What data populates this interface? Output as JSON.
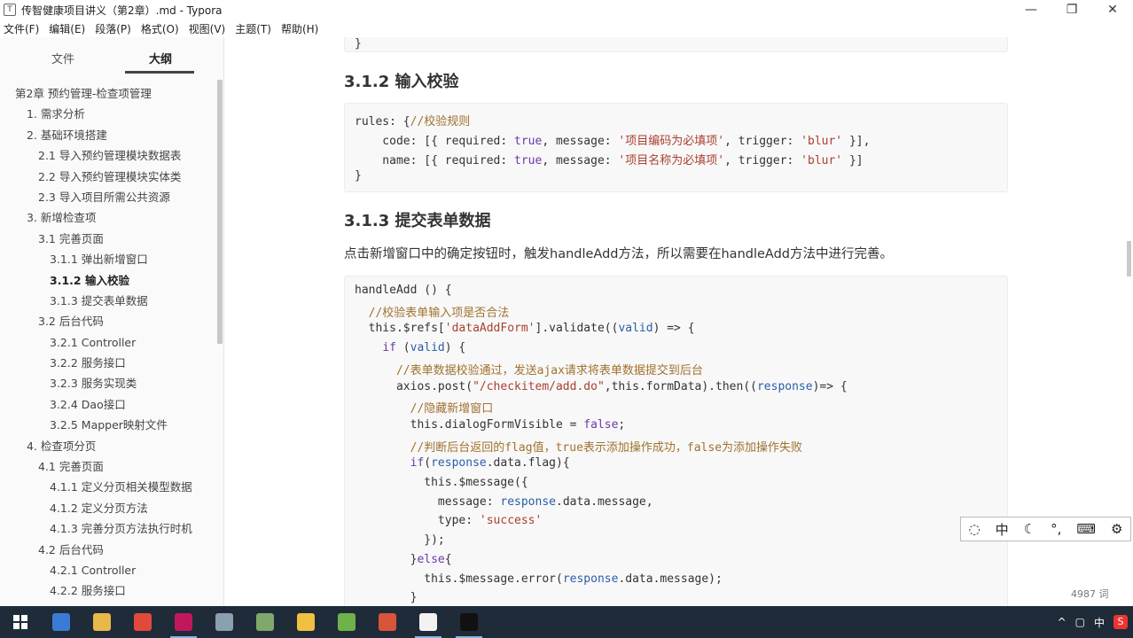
{
  "window": {
    "title": "传智健康项目讲义（第2章）.md - Typora",
    "app_icon": "T"
  },
  "window_controls": {
    "minimize": "—",
    "maximize": "❐",
    "close": "✕"
  },
  "menu": [
    "文件(F)",
    "编辑(E)",
    "段落(P)",
    "格式(O)",
    "视图(V)",
    "主题(T)",
    "帮助(H)"
  ],
  "sidebar": {
    "tabs": [
      "文件",
      "大纲"
    ],
    "active_tab": "大纲",
    "outline": [
      {
        "label": "第2章 预约管理-检查项管理",
        "level": 0
      },
      {
        "label": "1. 需求分析",
        "level": 1
      },
      {
        "label": "2. 基础环境搭建",
        "level": 1
      },
      {
        "label": "2.1 导入预约管理模块数据表",
        "level": 2
      },
      {
        "label": "2.2 导入预约管理模块实体类",
        "level": 2
      },
      {
        "label": "2.3 导入项目所需公共资源",
        "level": 2
      },
      {
        "label": "3. 新增检查项",
        "level": 1
      },
      {
        "label": "3.1 完善页面",
        "level": 2
      },
      {
        "label": "3.1.1 弹出新增窗口",
        "level": 3
      },
      {
        "label": "3.1.2 输入校验",
        "level": 3,
        "active": true
      },
      {
        "label": "3.1.3 提交表单数据",
        "level": 3
      },
      {
        "label": "3.2 后台代码",
        "level": 2
      },
      {
        "label": "3.2.1 Controller",
        "level": 3
      },
      {
        "label": "3.2.2 服务接口",
        "level": 3
      },
      {
        "label": "3.2.3 服务实现类",
        "level": 3
      },
      {
        "label": "3.2.4 Dao接口",
        "level": 3
      },
      {
        "label": "3.2.5 Mapper映射文件",
        "level": 3
      },
      {
        "label": "4. 检查项分页",
        "level": 1
      },
      {
        "label": "4.1 完善页面",
        "level": 2
      },
      {
        "label": "4.1.1 定义分页相关模型数据",
        "level": 3
      },
      {
        "label": "4.1.2 定义分页方法",
        "level": 3
      },
      {
        "label": "4.1.3 完善分页方法执行时机",
        "level": 3
      },
      {
        "label": "4.2 后台代码",
        "level": 2
      },
      {
        "label": "4.2.1 Controller",
        "level": 3
      },
      {
        "label": "4.2.2 服务接口",
        "level": 3
      }
    ],
    "bottom_icons": {
      "collapse": "‹",
      "source": "</>"
    }
  },
  "editor": {
    "top_code_tail": "}",
    "h_312": "3.1.2 输入校验",
    "rules_code": [
      [
        [
          "rules: {",
          "def"
        ],
        [
          "//校验规则",
          "cm"
        ]
      ],
      [
        [
          "    code: [{ required: ",
          "def"
        ],
        [
          "true",
          "kw"
        ],
        [
          ", message: ",
          "def"
        ],
        [
          "'项目编码为必填项'",
          "str"
        ],
        [
          ", trigger: ",
          "def"
        ],
        [
          "'blur'",
          "str"
        ],
        [
          " }],",
          "def"
        ]
      ],
      [
        [
          "    name: [{ required: ",
          "def"
        ],
        [
          "true",
          "kw"
        ],
        [
          ", message: ",
          "def"
        ],
        [
          "'项目名称为必填项'",
          "str"
        ],
        [
          ", trigger: ",
          "def"
        ],
        [
          "'blur'",
          "str"
        ],
        [
          " }]",
          "def"
        ]
      ],
      [
        [
          "}",
          "def"
        ]
      ]
    ],
    "h_313": "3.1.3 提交表单数据",
    "paragraph": "点击新增窗口中的确定按钮时，触发handleAdd方法，所以需要在handleAdd方法中进行完善。",
    "handle_code": [
      [
        [
          "handleAdd () {",
          "def"
        ]
      ],
      [
        [
          "  ",
          "def"
        ],
        [
          "//校验表单输入项是否合法",
          "cm"
        ]
      ],
      [
        [
          "  this.",
          "def"
        ],
        [
          "$refs[",
          "def"
        ],
        [
          "'dataAddForm'",
          "str"
        ],
        [
          "].validate((",
          "def"
        ],
        [
          "valid",
          "var"
        ],
        [
          ") => {",
          "def"
        ]
      ],
      [
        [
          "    ",
          "def"
        ],
        [
          "if",
          "kw"
        ],
        [
          " (",
          "def"
        ],
        [
          "valid",
          "var"
        ],
        [
          ") {",
          "def"
        ]
      ],
      [
        [
          "      ",
          "def"
        ],
        [
          "//表单数据校验通过，发送ajax请求将表单数据提交到后台",
          "cm"
        ]
      ],
      [
        [
          "      axios.post(",
          "def"
        ],
        [
          "\"/checkitem/add.do\"",
          "str"
        ],
        [
          ",this.formData).then((",
          "def"
        ],
        [
          "response",
          "var"
        ],
        [
          ")=> {",
          "def"
        ]
      ],
      [
        [
          "        ",
          "def"
        ],
        [
          "//隐藏新增窗口",
          "cm"
        ]
      ],
      [
        [
          "        this.dialogFormVisible = ",
          "def"
        ],
        [
          "false",
          "kw"
        ],
        [
          ";",
          "def"
        ]
      ],
      [
        [
          "        ",
          "def"
        ],
        [
          "//判断后台返回的flag值，true表示添加操作成功，false为添加操作失败",
          "cm"
        ]
      ],
      [
        [
          "        ",
          "def"
        ],
        [
          "if",
          "kw"
        ],
        [
          "(",
          "def"
        ],
        [
          "response",
          "var"
        ],
        [
          ".data.flag){",
          "def"
        ]
      ],
      [
        [
          "          this.$message({",
          "def"
        ]
      ],
      [
        [
          "            message: ",
          "def"
        ],
        [
          "response",
          "var"
        ],
        [
          ".data.message,",
          "def"
        ]
      ],
      [
        [
          "            type: ",
          "def"
        ],
        [
          "'success'",
          "str"
        ]
      ],
      [
        [
          "          });",
          "def"
        ]
      ],
      [
        [
          "        }",
          "def"
        ],
        [
          "else",
          "kw"
        ],
        [
          "{",
          "def"
        ]
      ],
      [
        [
          "          this.$message.error(",
          "def"
        ],
        [
          "response",
          "var"
        ],
        [
          ".data.message);",
          "def"
        ]
      ],
      [
        [
          "        }",
          "def"
        ]
      ]
    ]
  },
  "status": {
    "word_count": "4987 词"
  },
  "ime_bar": [
    "◌",
    "中",
    "☾",
    "°,",
    "⌨",
    "⚙"
  ],
  "taskbar": {
    "tray": [
      "^",
      "▢",
      "中",
      "S"
    ],
    "apps": [
      {
        "name": "task-view",
        "color": "#3a7bd5"
      },
      {
        "name": "file-explorer",
        "color": "#e8b84a"
      },
      {
        "name": "chrome",
        "color": "#e04a3a"
      },
      {
        "name": "intellij",
        "color": "#c2185b"
      },
      {
        "name": "app5",
        "color": "#8aa0b0"
      },
      {
        "name": "app6",
        "color": "#7fa86a"
      },
      {
        "name": "app7",
        "color": "#f0c040"
      },
      {
        "name": "app8",
        "color": "#6fb24a"
      },
      {
        "name": "app9",
        "color": "#d9553a"
      },
      {
        "name": "typora",
        "color": "#f2f2f2"
      },
      {
        "name": "terminal",
        "color": "#111111"
      }
    ]
  }
}
